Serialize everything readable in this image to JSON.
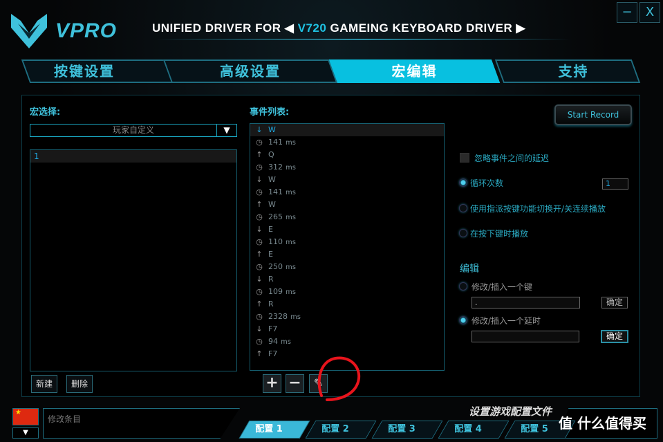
{
  "header": {
    "brand": "VPRO",
    "title_prefix": "UNIFIED DRIVER FOR",
    "model": "V720",
    "title_suffix": "GAMEING KEYBOARD DRIVER",
    "minimize": "−",
    "close": "X"
  },
  "tabs": [
    {
      "label": "按键设置"
    },
    {
      "label": "高级设置"
    },
    {
      "label": "宏编辑",
      "active": true
    },
    {
      "label": "支持"
    }
  ],
  "macro_select": {
    "label": "宏选择:",
    "dropdown_value": "玩家自定义",
    "items": [
      "1"
    ],
    "new_button": "新建",
    "delete_button": "删除"
  },
  "event_list": {
    "label": "事件列表:",
    "events": [
      {
        "type": "down",
        "text": "W"
      },
      {
        "type": "delay",
        "text": "141",
        "unit": "ms"
      },
      {
        "type": "up",
        "text": "Q"
      },
      {
        "type": "delay",
        "text": "312",
        "unit": "ms"
      },
      {
        "type": "down",
        "text": "W"
      },
      {
        "type": "delay",
        "text": "141",
        "unit": "ms"
      },
      {
        "type": "up",
        "text": "W"
      },
      {
        "type": "delay",
        "text": "265",
        "unit": "ms"
      },
      {
        "type": "down",
        "text": "E"
      },
      {
        "type": "delay",
        "text": "110",
        "unit": "ms"
      },
      {
        "type": "up",
        "text": "E"
      },
      {
        "type": "delay",
        "text": "250",
        "unit": "ms"
      },
      {
        "type": "down",
        "text": "R"
      },
      {
        "type": "delay",
        "text": "109",
        "unit": "ms"
      },
      {
        "type": "up",
        "text": "R"
      },
      {
        "type": "delay",
        "text": "2328",
        "unit": "ms"
      },
      {
        "type": "down",
        "text": "F7"
      },
      {
        "type": "delay",
        "text": "94",
        "unit": "ms"
      },
      {
        "type": "up",
        "text": "F7"
      }
    ],
    "add": "+",
    "remove": "−",
    "edit": "✎"
  },
  "options": {
    "start_record": "Start Record",
    "ignore_delay": "忽略事件之间的延迟",
    "ignore_delay_checked": false,
    "loop_count_label": "循环次数",
    "loop_count": "1",
    "toggle_label": "使用指派按键功能切换开/关连续播放",
    "hold_label": "在按下键时播放",
    "selected": "loop_count"
  },
  "edit": {
    "title": "编辑",
    "key_label": "修改/插入一个键",
    "key_value": ".",
    "delay_label": "修改/插入一个延时",
    "delay_value": "",
    "confirm": "确定",
    "selected": "delay"
  },
  "bottom": {
    "status_placeholder": "修改条目",
    "profile_title": "设置游戏配置文件",
    "profiles": [
      "配置 1",
      "配置 2",
      "配置 3",
      "配置 4",
      "配置 5"
    ],
    "active_profile": 0,
    "dropdown": "▼"
  },
  "watermark": "值 什么值得买",
  "colors": {
    "accent": "#08c0e0",
    "annotation": "#e8141c"
  }
}
